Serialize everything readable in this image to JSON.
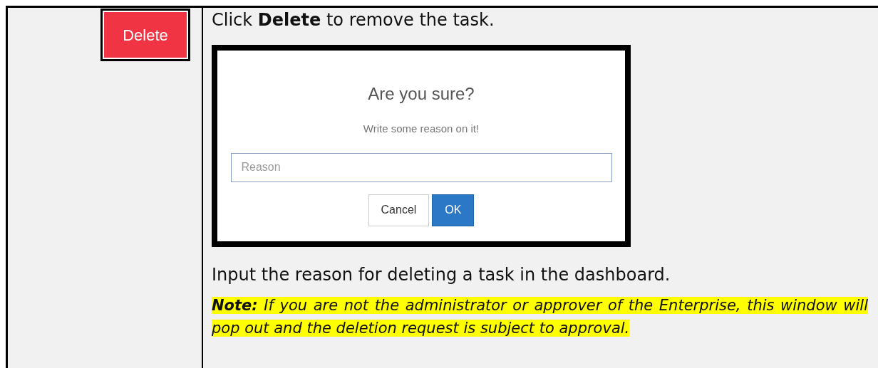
{
  "left_cell": {
    "delete_button": "Delete"
  },
  "instruction": "Click **Delete** to remove the task.",
  "dialog": {
    "title": "Are you sure?",
    "message": "Write some reason on it!",
    "reason_field": {
      "placeholder": "Reason"
    },
    "buttons": [
      {
        "label": "Cancel",
        "kind": "default"
      },
      {
        "label": "OK",
        "kind": "primary"
      }
    ]
  },
  "description": "Input the reason for deleting a task in the dashboard.",
  "note": "**Note:** If you are not the administrator or approver of the Enterprise, this window will pop out and the deletion request is subject to approval."
}
